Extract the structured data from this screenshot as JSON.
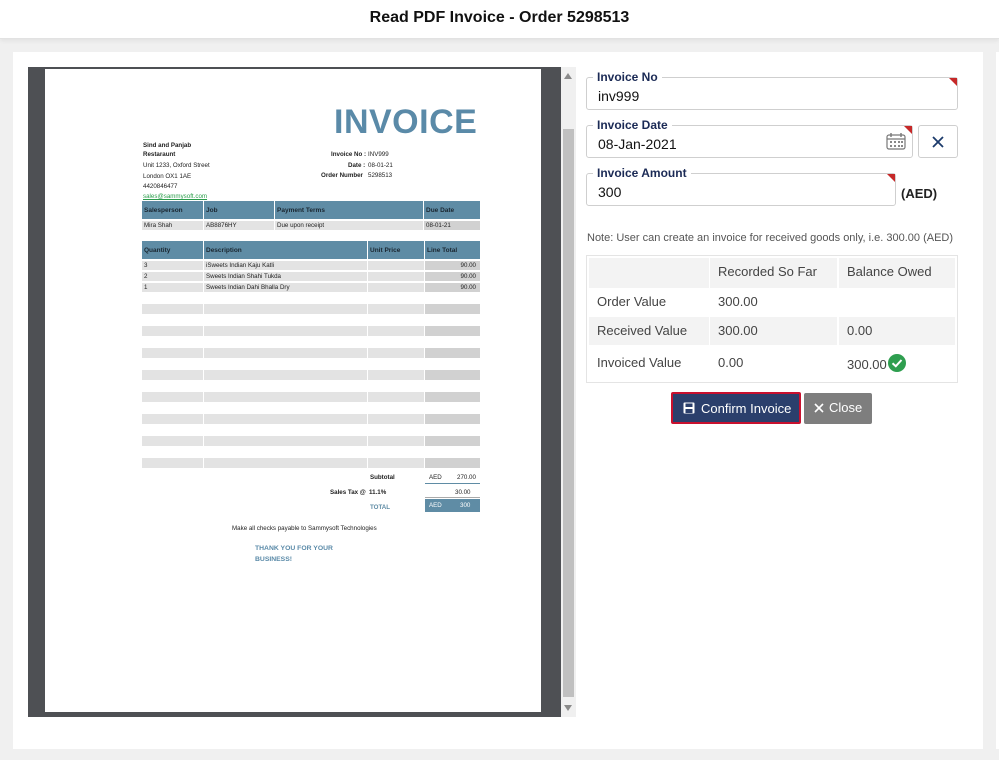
{
  "window": {
    "title": "Read PDF Invoice - Order 5298513"
  },
  "invoice_doc": {
    "heading": "INVOICE",
    "company": {
      "name_line1": "Sind and Panjab",
      "name_line2": "Restaraunt",
      "address_line1": "Unit 1233, Oxford Street",
      "address_line2": "London OX1 1AE",
      "phone": "4420846477",
      "email": "sales@sammysoft.com"
    },
    "meta": {
      "invoice_no_label": "Invoice No :",
      "invoice_no": "INV999",
      "date_label": "Date :",
      "date": "08-01-21",
      "order_number_label": "Order Number",
      "order_number": "5298513"
    },
    "job_table": {
      "headers": [
        "Salesperson",
        "Job",
        "Payment Terms",
        "Due Date"
      ],
      "row": [
        "Mira Shah",
        "AB8876HY",
        "Due upon receipt",
        "08-01-21"
      ]
    },
    "items_table": {
      "headers": [
        "Quantity",
        "Description",
        "Unit Price",
        "Line Total"
      ],
      "rows": [
        [
          "3",
          "iSweets Indian Kaju Katli",
          "",
          "90.00"
        ],
        [
          "2",
          "Sweets Indian Shahi Tukda",
          "",
          "90.00"
        ],
        [
          "1",
          "Sweets Indian Dahi Bhalla Dry",
          "",
          "90.00"
        ]
      ]
    },
    "totals": {
      "subtotal_label": "Subtotal",
      "subtotal_currency": "AED",
      "subtotal": "270.00",
      "tax_label": "Sales Tax @",
      "tax_rate": "11.1%",
      "tax": "30.00",
      "total_label": "TOTAL",
      "total_currency": "AED",
      "total": "300"
    },
    "checks_note": "Make all checks payable to Sammysoft Technologies",
    "thanks_line1": "THANK YOU FOR YOUR",
    "thanks_line2": "BUSINESS!"
  },
  "form": {
    "invoice_no": {
      "label": "Invoice No",
      "value": "inv999"
    },
    "invoice_date": {
      "label": "Invoice Date",
      "value": "08-Jan-2021"
    },
    "invoice_amount": {
      "label": "Invoice Amount",
      "value": "300",
      "currency": "(AED)"
    },
    "note": "Note: User can create an invoice for received goods only, i.e. 300.00 (AED)"
  },
  "summary_table": {
    "headers": [
      "",
      "Recorded So Far",
      "Balance Owed"
    ],
    "rows": [
      [
        "Order Value",
        "300.00",
        ""
      ],
      [
        "Received Value",
        "300.00",
        "0.00"
      ],
      [
        "Invoiced Value",
        "0.00",
        "300.00"
      ]
    ]
  },
  "buttons": {
    "confirm": "Confirm Invoice",
    "close": "Close"
  },
  "icons": {
    "check": "check-circle-icon",
    "calendar": "calendar-icon",
    "clear": "close-icon",
    "save": "save-icon"
  },
  "colors": {
    "accent": "#2b3f6c",
    "invoice_blue": "#5f8ca5",
    "success": "#2e9e4f",
    "required": "#c62828"
  }
}
